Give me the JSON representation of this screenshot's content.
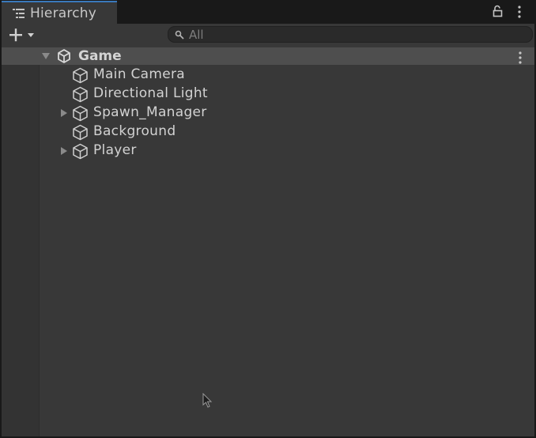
{
  "tab": {
    "title": "Hierarchy",
    "icon": "hierarchy-list-icon"
  },
  "header_buttons": {
    "lock_icon": "lock-icon",
    "menu_icon": "kebab-menu-icon"
  },
  "toolbar": {
    "add_icon": "plus-icon",
    "dropdown_icon": "chevron-down-icon",
    "search": {
      "placeholder": "All",
      "value": ""
    }
  },
  "scene": {
    "name": "Game",
    "expanded": true,
    "icon": "unity-logo-icon",
    "menu_icon": "kebab-menu-icon"
  },
  "objects": [
    {
      "name": "Main Camera",
      "has_children": false
    },
    {
      "name": "Directional Light",
      "has_children": false
    },
    {
      "name": "Spawn_Manager",
      "has_children": true
    },
    {
      "name": "Background",
      "has_children": false
    },
    {
      "name": "Player",
      "has_children": true
    }
  ],
  "colors": {
    "tab_accent": "#3a79bb",
    "panel_bg": "#383838",
    "scene_header_bg": "#4e4e4e",
    "text": "#d2d2d2"
  }
}
